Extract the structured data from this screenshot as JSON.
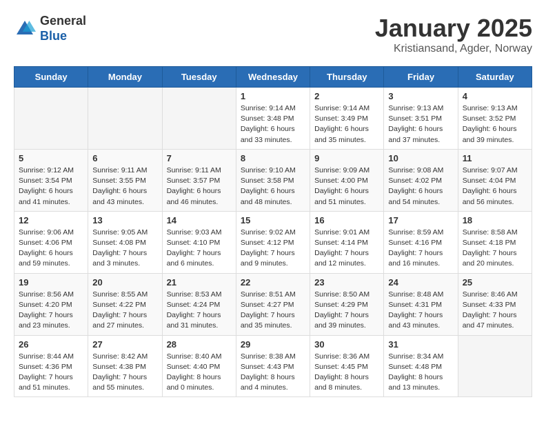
{
  "logo": {
    "general": "General",
    "blue": "Blue"
  },
  "header": {
    "title": "January 2025",
    "subtitle": "Kristiansand, Agder, Norway"
  },
  "weekdays": [
    "Sunday",
    "Monday",
    "Tuesday",
    "Wednesday",
    "Thursday",
    "Friday",
    "Saturday"
  ],
  "weeks": [
    [
      {
        "day": "",
        "info": ""
      },
      {
        "day": "",
        "info": ""
      },
      {
        "day": "",
        "info": ""
      },
      {
        "day": "1",
        "info": "Sunrise: 9:14 AM\nSunset: 3:48 PM\nDaylight: 6 hours and 33 minutes."
      },
      {
        "day": "2",
        "info": "Sunrise: 9:14 AM\nSunset: 3:49 PM\nDaylight: 6 hours and 35 minutes."
      },
      {
        "day": "3",
        "info": "Sunrise: 9:13 AM\nSunset: 3:51 PM\nDaylight: 6 hours and 37 minutes."
      },
      {
        "day": "4",
        "info": "Sunrise: 9:13 AM\nSunset: 3:52 PM\nDaylight: 6 hours and 39 minutes."
      }
    ],
    [
      {
        "day": "5",
        "info": "Sunrise: 9:12 AM\nSunset: 3:54 PM\nDaylight: 6 hours and 41 minutes."
      },
      {
        "day": "6",
        "info": "Sunrise: 9:11 AM\nSunset: 3:55 PM\nDaylight: 6 hours and 43 minutes."
      },
      {
        "day": "7",
        "info": "Sunrise: 9:11 AM\nSunset: 3:57 PM\nDaylight: 6 hours and 46 minutes."
      },
      {
        "day": "8",
        "info": "Sunrise: 9:10 AM\nSunset: 3:58 PM\nDaylight: 6 hours and 48 minutes."
      },
      {
        "day": "9",
        "info": "Sunrise: 9:09 AM\nSunset: 4:00 PM\nDaylight: 6 hours and 51 minutes."
      },
      {
        "day": "10",
        "info": "Sunrise: 9:08 AM\nSunset: 4:02 PM\nDaylight: 6 hours and 54 minutes."
      },
      {
        "day": "11",
        "info": "Sunrise: 9:07 AM\nSunset: 4:04 PM\nDaylight: 6 hours and 56 minutes."
      }
    ],
    [
      {
        "day": "12",
        "info": "Sunrise: 9:06 AM\nSunset: 4:06 PM\nDaylight: 6 hours and 59 minutes."
      },
      {
        "day": "13",
        "info": "Sunrise: 9:05 AM\nSunset: 4:08 PM\nDaylight: 7 hours and 3 minutes."
      },
      {
        "day": "14",
        "info": "Sunrise: 9:03 AM\nSunset: 4:10 PM\nDaylight: 7 hours and 6 minutes."
      },
      {
        "day": "15",
        "info": "Sunrise: 9:02 AM\nSunset: 4:12 PM\nDaylight: 7 hours and 9 minutes."
      },
      {
        "day": "16",
        "info": "Sunrise: 9:01 AM\nSunset: 4:14 PM\nDaylight: 7 hours and 12 minutes."
      },
      {
        "day": "17",
        "info": "Sunrise: 8:59 AM\nSunset: 4:16 PM\nDaylight: 7 hours and 16 minutes."
      },
      {
        "day": "18",
        "info": "Sunrise: 8:58 AM\nSunset: 4:18 PM\nDaylight: 7 hours and 20 minutes."
      }
    ],
    [
      {
        "day": "19",
        "info": "Sunrise: 8:56 AM\nSunset: 4:20 PM\nDaylight: 7 hours and 23 minutes."
      },
      {
        "day": "20",
        "info": "Sunrise: 8:55 AM\nSunset: 4:22 PM\nDaylight: 7 hours and 27 minutes."
      },
      {
        "day": "21",
        "info": "Sunrise: 8:53 AM\nSunset: 4:24 PM\nDaylight: 7 hours and 31 minutes."
      },
      {
        "day": "22",
        "info": "Sunrise: 8:51 AM\nSunset: 4:27 PM\nDaylight: 7 hours and 35 minutes."
      },
      {
        "day": "23",
        "info": "Sunrise: 8:50 AM\nSunset: 4:29 PM\nDaylight: 7 hours and 39 minutes."
      },
      {
        "day": "24",
        "info": "Sunrise: 8:48 AM\nSunset: 4:31 PM\nDaylight: 7 hours and 43 minutes."
      },
      {
        "day": "25",
        "info": "Sunrise: 8:46 AM\nSunset: 4:33 PM\nDaylight: 7 hours and 47 minutes."
      }
    ],
    [
      {
        "day": "26",
        "info": "Sunrise: 8:44 AM\nSunset: 4:36 PM\nDaylight: 7 hours and 51 minutes."
      },
      {
        "day": "27",
        "info": "Sunrise: 8:42 AM\nSunset: 4:38 PM\nDaylight: 7 hours and 55 minutes."
      },
      {
        "day": "28",
        "info": "Sunrise: 8:40 AM\nSunset: 4:40 PM\nDaylight: 8 hours and 0 minutes."
      },
      {
        "day": "29",
        "info": "Sunrise: 8:38 AM\nSunset: 4:43 PM\nDaylight: 8 hours and 4 minutes."
      },
      {
        "day": "30",
        "info": "Sunrise: 8:36 AM\nSunset: 4:45 PM\nDaylight: 8 hours and 8 minutes."
      },
      {
        "day": "31",
        "info": "Sunrise: 8:34 AM\nSunset: 4:48 PM\nDaylight: 8 hours and 13 minutes."
      },
      {
        "day": "",
        "info": ""
      }
    ]
  ]
}
